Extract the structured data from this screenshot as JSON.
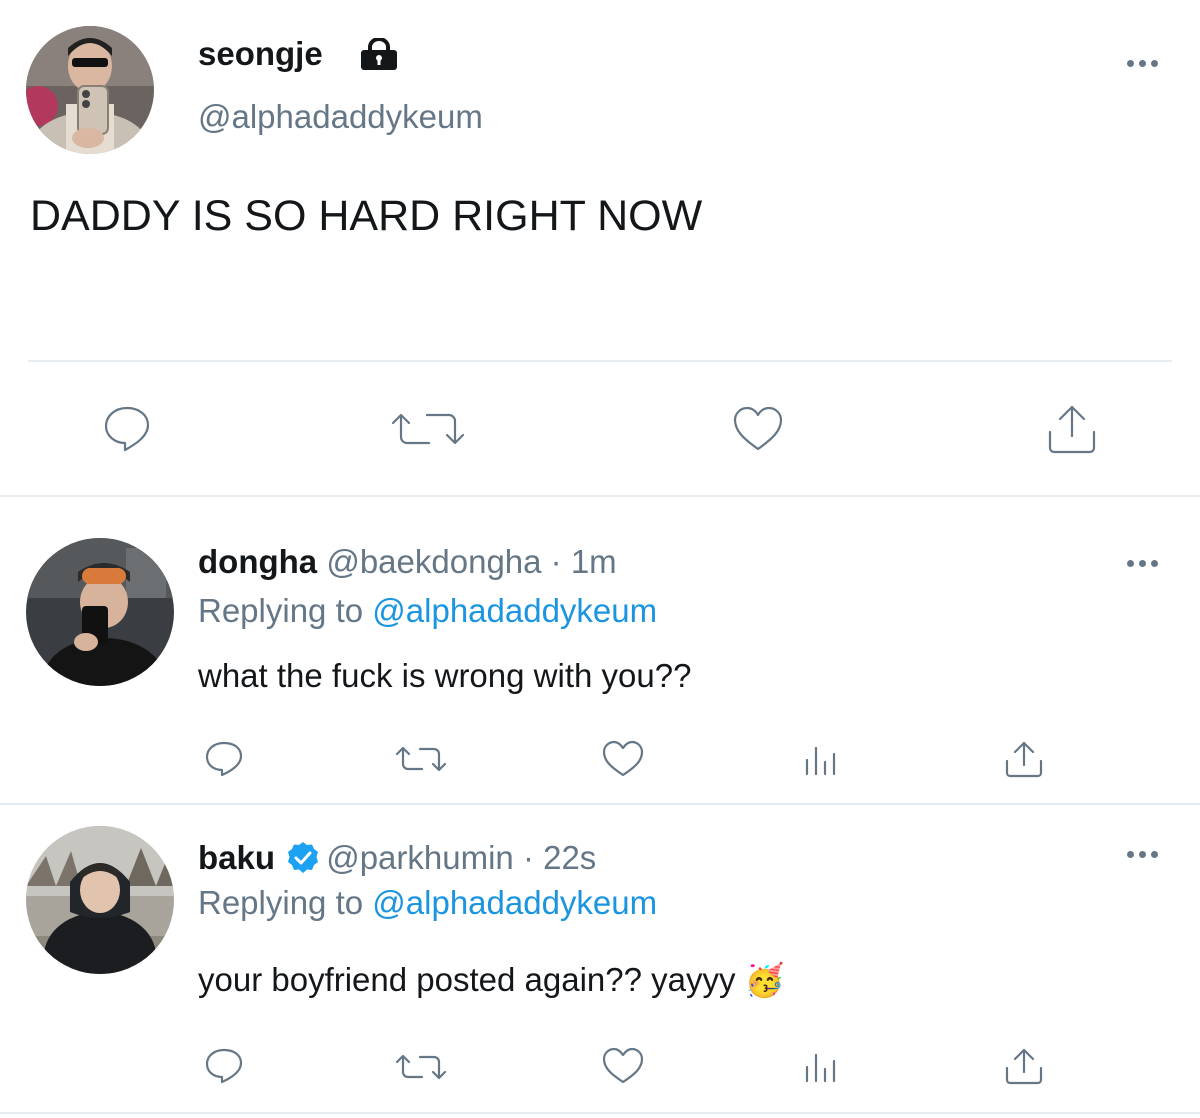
{
  "main_tweet": {
    "display_name": "seongje",
    "handle": "@alphadaddykeum",
    "text": "DADDY IS SO HARD RIGHT NOW",
    "protected_icon": "lock-icon",
    "more_icon": "more-icon",
    "actions": [
      "reply-icon",
      "retweet-icon",
      "like-icon",
      "share-icon"
    ]
  },
  "replies": [
    {
      "display_name": "dongha",
      "handle_time": "@baekdongha · 1m",
      "replying_prefix": "Replying to",
      "replying_handle": "@alphadaddykeum",
      "text": "what the fuck is wrong with you??",
      "verified": false,
      "actions": [
        "reply-icon",
        "retweet-icon",
        "like-icon",
        "analytics-icon",
        "share-icon"
      ]
    },
    {
      "display_name": "baku",
      "handle_time": "@parkhumin · 22s",
      "replying_prefix": "Replying to",
      "replying_handle": "@alphadaddykeum",
      "text": "your boyfriend posted again?? yayyy",
      "emoji": "🥳",
      "verified": true,
      "actions": [
        "reply-icon",
        "retweet-icon",
        "like-icon",
        "analytics-icon",
        "share-icon"
      ]
    }
  ],
  "colors": {
    "text": "#14171a",
    "muted": "#657786",
    "link": "#1b95e0",
    "verified": "#1da1f2",
    "divider": "#e6ecf0"
  }
}
